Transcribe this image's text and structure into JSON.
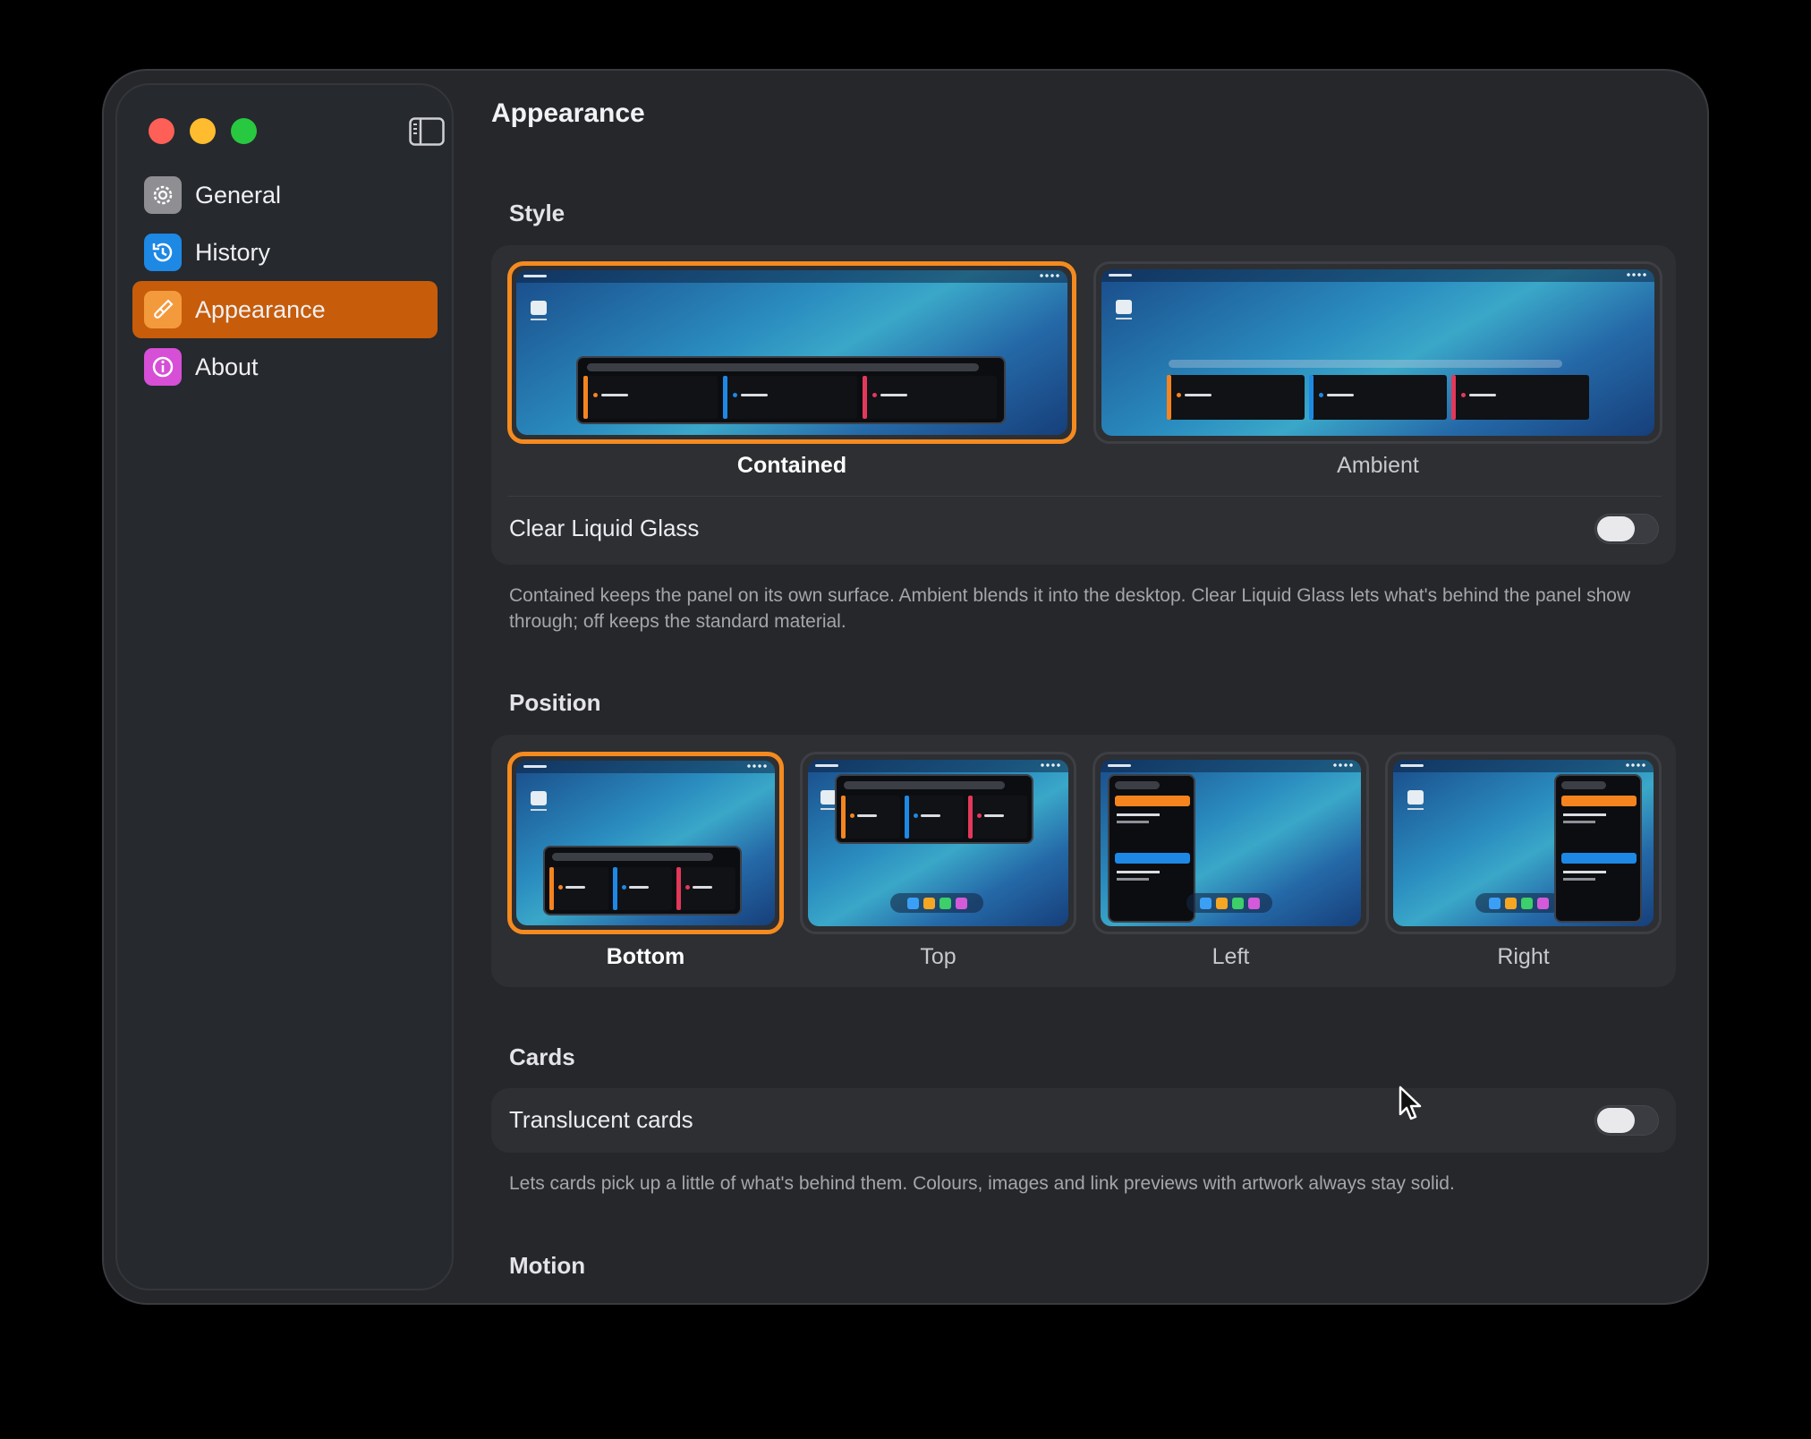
{
  "window": {
    "sidebar": {
      "items": [
        {
          "label": "General",
          "icon": "gear-icon",
          "color": "#8e8e93"
        },
        {
          "label": "History",
          "icon": "history-clock-icon",
          "color": "#1e88e5"
        },
        {
          "label": "Appearance",
          "icon": "paintbrush-icon",
          "color": "#f39a3d",
          "active": true
        },
        {
          "label": "About",
          "icon": "info-icon",
          "color": "#d64fd6"
        }
      ]
    },
    "title": "Appearance"
  },
  "style": {
    "heading": "Style",
    "options": [
      {
        "label": "Contained",
        "selected": true
      },
      {
        "label": "Ambient",
        "selected": false
      }
    ],
    "clear_glass": {
      "label": "Clear Liquid Glass",
      "on": false
    },
    "description": "Contained keeps the panel on its own surface. Ambient blends it into the desktop. Clear Liquid Glass lets what's behind the panel show through; off keeps the standard material."
  },
  "position": {
    "heading": "Position",
    "options": [
      {
        "label": "Bottom",
        "selected": true
      },
      {
        "label": "Top",
        "selected": false
      },
      {
        "label": "Left",
        "selected": false
      },
      {
        "label": "Right",
        "selected": false
      }
    ]
  },
  "cards": {
    "heading": "Cards",
    "translucent": {
      "label": "Translucent cards",
      "on": false
    },
    "description": "Lets cards pick up a little of what's behind them. Colours, images and link previews with artwork always stay solid."
  },
  "motion": {
    "heading": "Motion"
  },
  "colors": {
    "accent": "#f58a1f",
    "sidebar_active": "#c75c0a"
  }
}
